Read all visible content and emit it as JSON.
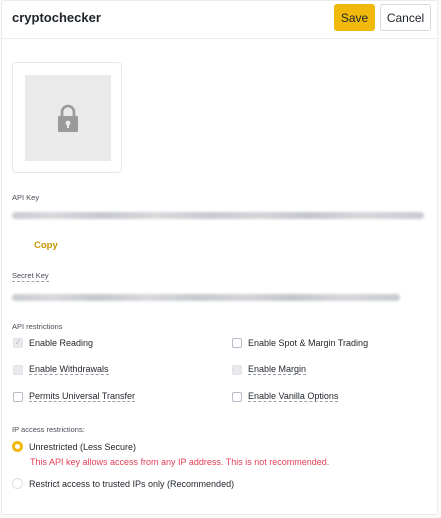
{
  "header": {
    "title": "cryptochecker",
    "save_label": "Save",
    "cancel_label": "Cancel"
  },
  "qr": {
    "icon": "lock-icon"
  },
  "api_key": {
    "label": "API Key",
    "copy_label": "Copy"
  },
  "secret_key": {
    "label": "Secret Key"
  },
  "restrictions": {
    "heading": "API restrictions",
    "options": [
      {
        "label": "Enable Reading",
        "checked": true,
        "disabled": true
      },
      {
        "label": "Enable Spot & Margin Trading",
        "checked": false,
        "disabled": false
      },
      {
        "label": "Enable Withdrawals",
        "checked": false,
        "disabled": true
      },
      {
        "label": "Enable Margin",
        "checked": false,
        "disabled": true
      },
      {
        "label": "Permits Universal Transfer",
        "checked": false,
        "disabled": false
      },
      {
        "label": "Enable Vanilla Options",
        "checked": false,
        "disabled": false
      }
    ]
  },
  "ip_access": {
    "heading": "IP access restrictions:",
    "unrestricted_label": "Unrestricted (Less Secure)",
    "warning": "This API key allows access from any IP address. This is not recommended.",
    "restricted_label": "Restrict access to trusted IPs only (Recommended)",
    "selected": "unrestricted"
  },
  "colors": {
    "accent": "#f0b90b",
    "link": "#c99400",
    "warning": "#e33e54"
  }
}
